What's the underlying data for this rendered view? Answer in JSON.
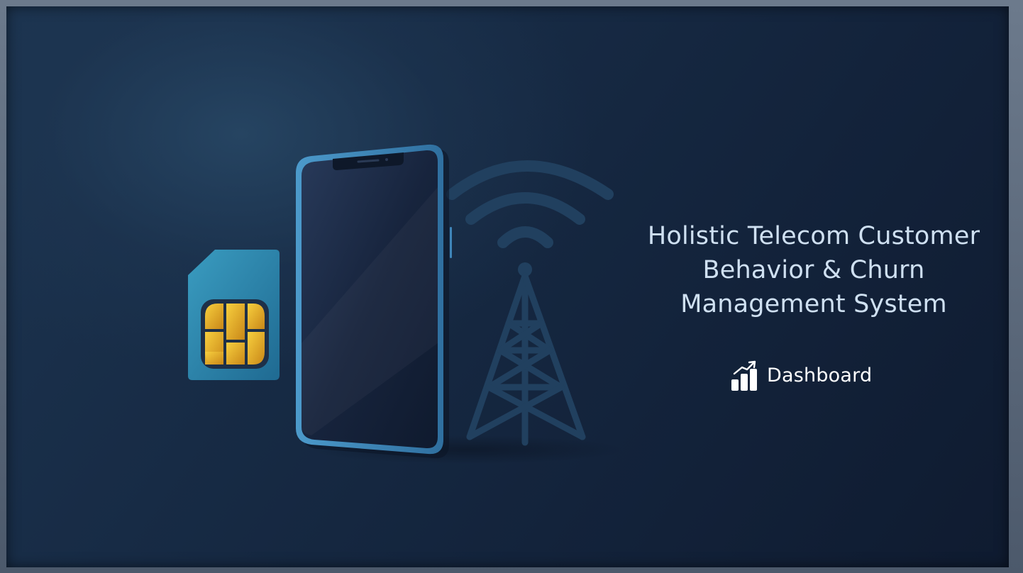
{
  "hero": {
    "title": "Holistic Telecom Customer\nBehavior & Churn\nManagement System",
    "illustration_icons": [
      "sim-card-icon",
      "smartphone-icon",
      "cell-tower-icon",
      "wifi-signal-icon"
    ]
  },
  "nav": {
    "dashboard_label": "Dashboard",
    "dashboard_icon": "bar-chart-trend-icon"
  },
  "colors": {
    "background_dark": "#0f1b30",
    "background_light": "#1c3450",
    "title_text": "#cfe0f1",
    "sim_card": "#2f84a8",
    "sim_chip": "#e8a92a",
    "phone_frame": "#3f86ba",
    "tower": "#21405f"
  }
}
